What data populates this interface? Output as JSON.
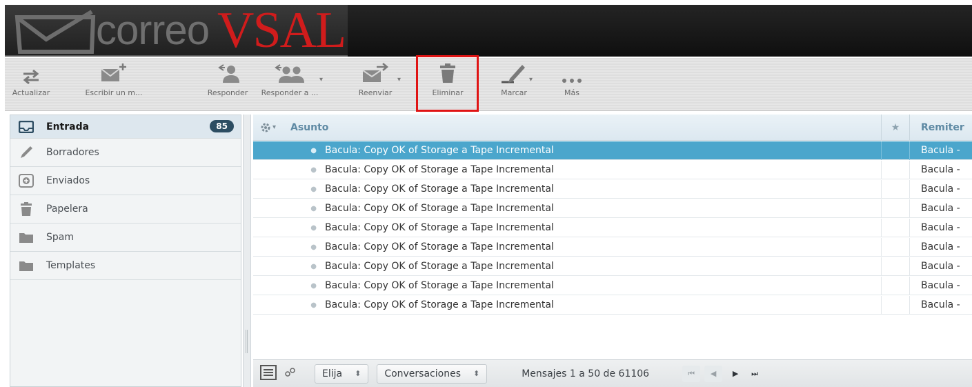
{
  "app": {
    "logo_text": "correo",
    "logo_accent": "VSAL"
  },
  "toolbar": {
    "refresh": "Actualizar",
    "compose": "Escribir un m...",
    "reply": "Responder",
    "reply_all": "Responder a ...",
    "forward": "Reenviar",
    "delete": "Eliminar",
    "mark": "Marcar",
    "more": "Más"
  },
  "folders": [
    {
      "name": "Entrada",
      "icon": "inbox-icon",
      "count": "85"
    },
    {
      "name": "Borradores",
      "icon": "pencil-icon"
    },
    {
      "name": "Enviados",
      "icon": "sent-icon"
    },
    {
      "name": "Papelera",
      "icon": "trash-icon"
    },
    {
      "name": "Spam",
      "icon": "folder-icon"
    },
    {
      "name": "Templates",
      "icon": "folder-icon"
    }
  ],
  "list": {
    "columns": {
      "subject": "Asunto",
      "flag": "★",
      "from": "Remiter"
    },
    "rows": [
      {
        "subject": "Bacula: Copy OK of Storage a Tape Incremental",
        "from": "Bacula -",
        "selected": true
      },
      {
        "subject": "Bacula: Copy OK of Storage a Tape Incremental",
        "from": "Bacula -"
      },
      {
        "subject": "Bacula: Copy OK of Storage a Tape Incremental",
        "from": "Bacula -"
      },
      {
        "subject": "Bacula: Copy OK of Storage a Tape Incremental",
        "from": "Bacula -"
      },
      {
        "subject": "Bacula: Copy OK of Storage a Tape Incremental",
        "from": "Bacula -"
      },
      {
        "subject": "Bacula: Copy OK of Storage a Tape Incremental",
        "from": "Bacula -"
      },
      {
        "subject": "Bacula: Copy OK of Storage a Tape Incremental",
        "from": "Bacula -"
      },
      {
        "subject": "Bacula: Copy OK of Storage a Tape Incremental",
        "from": "Bacula -"
      },
      {
        "subject": "Bacula: Copy OK of Storage a Tape Incremental",
        "from": "Bacula -"
      }
    ]
  },
  "footer": {
    "select_label": "Elija",
    "threads_label": "Conversaciones",
    "count_text": "Mensajes 1 a 50 de 61106"
  },
  "colors": {
    "accent_red": "#d01c1c",
    "selected_row": "#4ba6cc",
    "badge": "#2d4d62"
  }
}
